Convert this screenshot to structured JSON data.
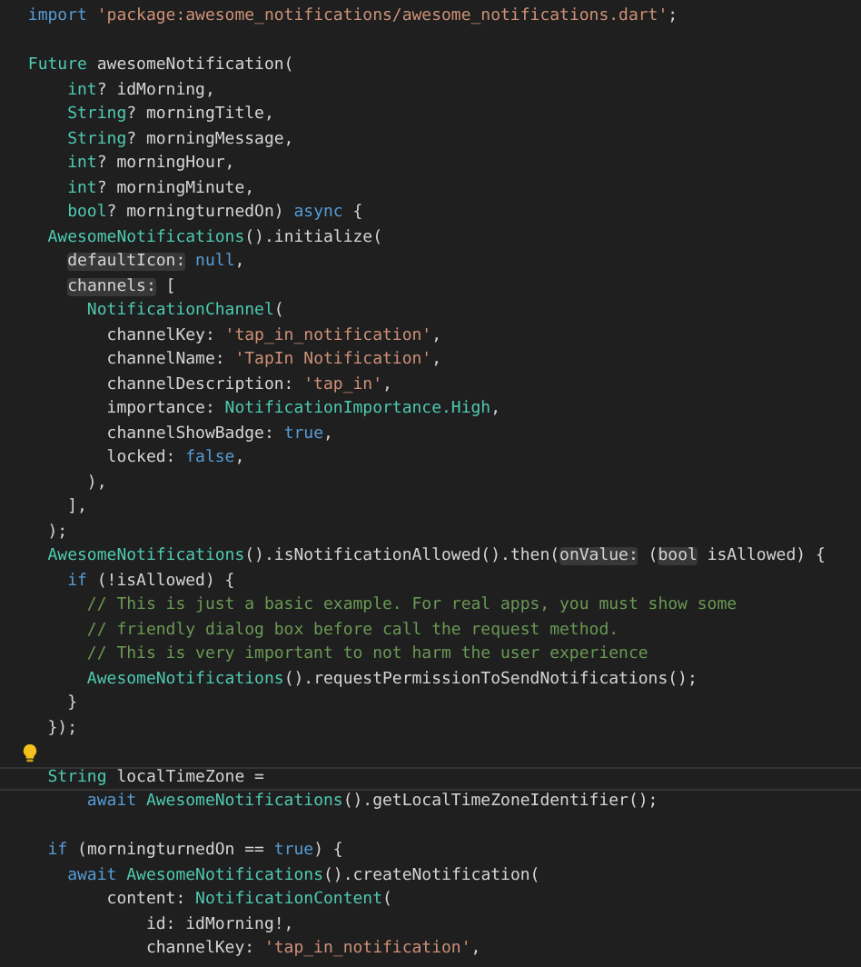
{
  "editor": {
    "lines": [
      {
        "tokens": [
          {
            "kind": "keyword",
            "text": "import "
          },
          {
            "kind": "string",
            "text": "'package:awesome_notifications/awesome_notifications.dart'"
          },
          {
            "kind": "plain",
            "text": ";"
          }
        ]
      },
      {
        "lightbulb": false
      },
      {
        "tokens": [
          {
            "kind": "type",
            "text": "Future"
          },
          {
            "kind": "plain",
            "text": " awesomeNotification("
          }
        ]
      },
      {
        "tokens": [
          {
            "kind": "type",
            "text": "    int"
          },
          {
            "kind": "plain",
            "text": "? idMorning,"
          }
        ]
      },
      {
        "tokens": [
          {
            "kind": "type",
            "text": "    String"
          },
          {
            "kind": "plain",
            "text": "? morningTitle,"
          }
        ]
      },
      {
        "tokens": [
          {
            "kind": "type",
            "text": "    String"
          },
          {
            "kind": "plain",
            "text": "? morningMessage,"
          }
        ]
      },
      {
        "tokens": [
          {
            "kind": "type",
            "text": "    int"
          },
          {
            "kind": "plain",
            "text": "? morningHour,"
          }
        ]
      },
      {
        "tokens": [
          {
            "kind": "type",
            "text": "    int"
          },
          {
            "kind": "plain",
            "text": "? morningMinute,"
          }
        ]
      },
      {
        "tokens": [
          {
            "kind": "type",
            "text": "    bool"
          },
          {
            "kind": "plain",
            "text": "? morningturnedOn) "
          },
          {
            "kind": "keyword",
            "text": "async"
          },
          {
            "kind": "plain",
            "text": " {"
          }
        ]
      },
      {
        "tokens": [
          {
            "kind": "type",
            "text": "  AwesomeNotifications"
          },
          {
            "kind": "plain",
            "text": "().initialize("
          }
        ]
      },
      {
        "tokens": [
          {
            "kind": "hint",
            "text": "    defaultIcon:"
          },
          {
            "kind": "keyword",
            "text": " null"
          },
          {
            "kind": "plain",
            "text": ","
          }
        ]
      },
      {
        "tokens": [
          {
            "kind": "hint",
            "text": "    channels:"
          },
          {
            "kind": "plain",
            "text": " ["
          }
        ]
      },
      {
        "tokens": [
          {
            "kind": "type",
            "text": "      NotificationChannel"
          },
          {
            "kind": "plain",
            "text": "("
          }
        ]
      },
      {
        "tokens": [
          {
            "kind": "plain",
            "text": "        channelKey: "
          },
          {
            "kind": "string",
            "text": "'tap_in_notification'"
          },
          {
            "kind": "plain",
            "text": ","
          }
        ]
      },
      {
        "tokens": [
          {
            "kind": "plain",
            "text": "        channelName: "
          },
          {
            "kind": "string",
            "text": "'TapIn Notification'"
          },
          {
            "kind": "plain",
            "text": ","
          }
        ]
      },
      {
        "tokens": [
          {
            "kind": "plain",
            "text": "        channelDescription: "
          },
          {
            "kind": "string",
            "text": "'tap_in'"
          },
          {
            "kind": "plain",
            "text": ","
          }
        ]
      },
      {
        "tokens": [
          {
            "kind": "plain",
            "text": "        importance: "
          },
          {
            "kind": "type",
            "text": "NotificationImportance.High"
          },
          {
            "kind": "plain",
            "text": ","
          }
        ]
      },
      {
        "tokens": [
          {
            "kind": "plain",
            "text": "        channelShowBadge: "
          },
          {
            "kind": "keyword",
            "text": "true"
          },
          {
            "kind": "plain",
            "text": ","
          }
        ]
      },
      {
        "tokens": [
          {
            "kind": "plain",
            "text": "        locked: "
          },
          {
            "kind": "keyword",
            "text": "false"
          },
          {
            "kind": "plain",
            "text": ","
          }
        ]
      },
      {
        "tokens": [
          {
            "kind": "plain",
            "text": "      ),"
          }
        ]
      },
      {
        "tokens": [
          {
            "kind": "plain",
            "text": "    ],"
          }
        ]
      },
      {
        "tokens": [
          {
            "kind": "plain",
            "text": "  );"
          }
        ]
      },
      {
        "tokens": [
          {
            "kind": "type",
            "text": "  AwesomeNotifications"
          },
          {
            "kind": "plain",
            "text": "().isNotificationAllowed().then("
          },
          {
            "kind": "hint",
            "text": "onValue:"
          },
          {
            "kind": "plain",
            "text": " ("
          },
          {
            "kind": "hint",
            "text": "bool"
          },
          {
            "kind": "plain",
            "text": " isAllowed) {"
          }
        ]
      },
      {
        "tokens": [
          {
            "kind": "keyword",
            "text": "    if"
          },
          {
            "kind": "plain",
            "text": " (!isAllowed) {"
          }
        ]
      },
      {
        "tokens": [
          {
            "kind": "comment",
            "text": "      // This is just a basic example. For real apps, you must show some"
          }
        ]
      },
      {
        "tokens": [
          {
            "kind": "comment",
            "text": "      // friendly dialog box before call the request method."
          }
        ]
      },
      {
        "tokens": [
          {
            "kind": "comment",
            "text": "      // This is very important to not harm the user experience"
          }
        ]
      },
      {
        "tokens": [
          {
            "kind": "type",
            "text": "      AwesomeNotifications"
          },
          {
            "kind": "plain",
            "text": "().requestPermissionToSendNotifications();"
          }
        ]
      },
      {
        "tokens": [
          {
            "kind": "plain",
            "text": "    }"
          }
        ]
      },
      {
        "tokens": [
          {
            "kind": "plain",
            "text": "  });"
          }
        ]
      },
      {
        "lightbulb": true
      },
      {
        "current": true,
        "tokens": [
          {
            "kind": "type",
            "text": "  String"
          },
          {
            "kind": "plain",
            "text": " localTimeZone ="
          }
        ]
      },
      {
        "tokens": [
          {
            "kind": "keyword",
            "text": "      await"
          },
          {
            "kind": "type",
            "text": " AwesomeNotifications"
          },
          {
            "kind": "plain",
            "text": "().getLocalTimeZoneIdentifier();"
          }
        ]
      },
      {
        "lightbulb": false
      },
      {
        "tokens": [
          {
            "kind": "keyword",
            "text": "  if"
          },
          {
            "kind": "plain",
            "text": " (morningturnedOn == "
          },
          {
            "kind": "keyword",
            "text": "true"
          },
          {
            "kind": "plain",
            "text": ") {"
          }
        ]
      },
      {
        "tokens": [
          {
            "kind": "keyword",
            "text": "    await"
          },
          {
            "kind": "type",
            "text": " AwesomeNotifications"
          },
          {
            "kind": "plain",
            "text": "().createNotification("
          }
        ]
      },
      {
        "tokens": [
          {
            "kind": "plain",
            "text": "        content: "
          },
          {
            "kind": "type",
            "text": "NotificationContent"
          },
          {
            "kind": "plain",
            "text": "("
          }
        ]
      },
      {
        "tokens": [
          {
            "kind": "plain",
            "text": "            id: idMorning!,"
          }
        ]
      },
      {
        "tokens": [
          {
            "kind": "plain",
            "text": "            channelKey: "
          },
          {
            "kind": "string",
            "text": "'tap_in_notification'"
          },
          {
            "kind": "plain",
            "text": ","
          }
        ]
      }
    ]
  }
}
